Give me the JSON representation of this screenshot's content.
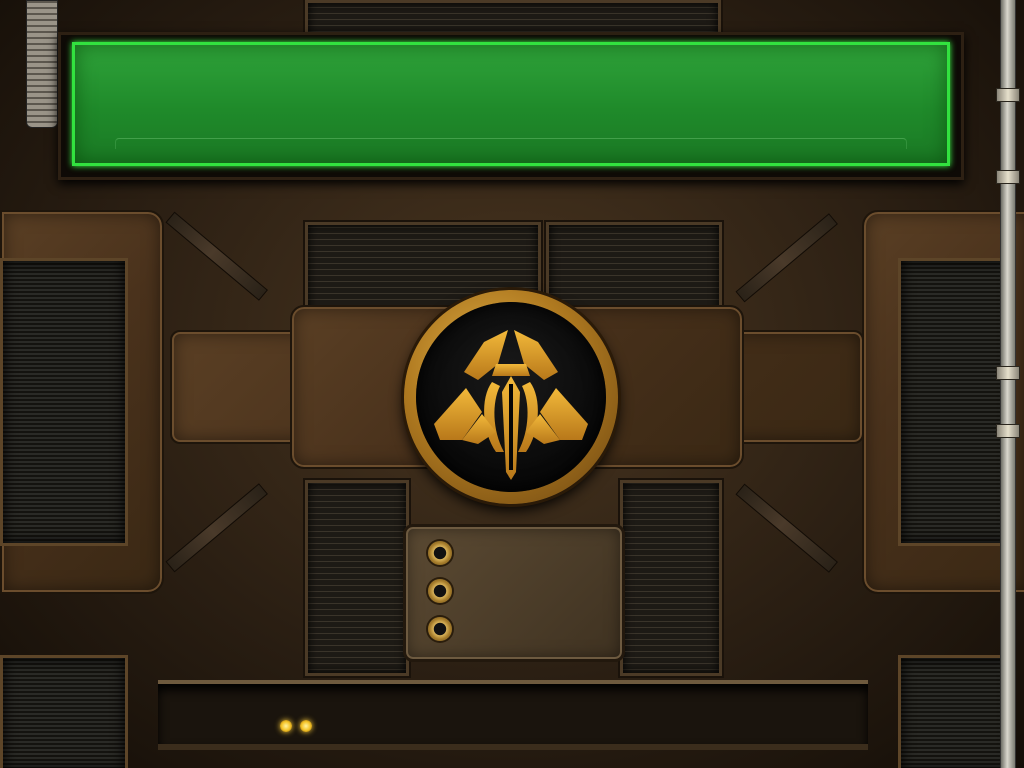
{
  "screen": {
    "type": "loading-screen",
    "banner": {
      "text": "",
      "color": "#2fa33a",
      "border_color": "#32e23f"
    },
    "emblem": {
      "icon": "faction-claw-emblem",
      "ring_color": "#c8922c",
      "glyph_color": "#e0a22a"
    },
    "console_plate": {
      "indicator_count": 3
    },
    "rail_lights": {
      "count": 2,
      "color": "#f5c52a"
    },
    "colors": {
      "metal": "#4a321c",
      "rust": "#5a3f24",
      "grille": "#221d16"
    }
  }
}
